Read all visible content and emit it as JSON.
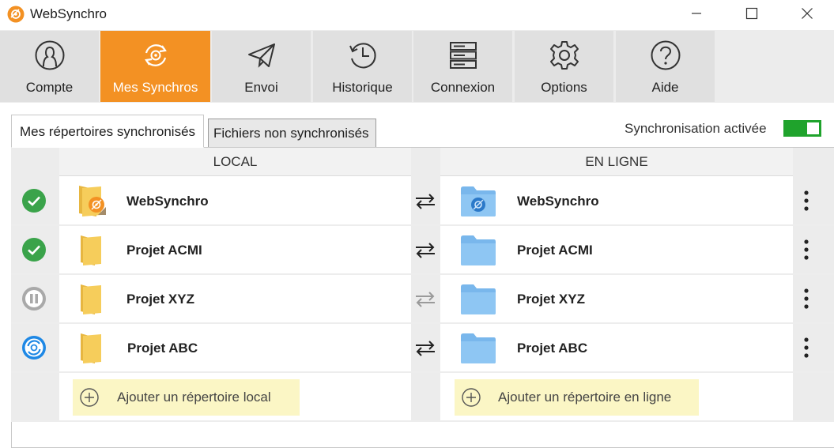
{
  "window": {
    "title": "WebSynchro",
    "controls": [
      "minimize-icon",
      "maximize-icon",
      "close-icon"
    ]
  },
  "toolbar": {
    "items": [
      {
        "label": "Compte",
        "icon": "account-icon"
      },
      {
        "label": "Mes Synchros",
        "icon": "sync-icon",
        "active": true
      },
      {
        "label": "Envoi",
        "icon": "send-icon"
      },
      {
        "label": "Historique",
        "icon": "history-icon"
      },
      {
        "label": "Connexion",
        "icon": "server-icon"
      },
      {
        "label": "Options",
        "icon": "gear-icon"
      },
      {
        "label": "Aide",
        "icon": "help-icon"
      }
    ]
  },
  "tabs": {
    "active": "Mes répertoires synchronisés",
    "inactive": "Fichiers non synchronisés"
  },
  "sync_toggle": {
    "label": "Synchronisation activée",
    "enabled": true
  },
  "table": {
    "headers": {
      "local": "LOCAL",
      "online": "EN LIGNE"
    },
    "rows": [
      {
        "status": "synced-check-icon",
        "local": "WebSynchro",
        "online": "WebSynchro",
        "arrows": "active"
      },
      {
        "status": "synced-check-icon",
        "local": "Projet ACMI",
        "online": "Projet ACMI",
        "arrows": "active"
      },
      {
        "status": "paused-icon",
        "local": "Projet XYZ",
        "online": "Projet XYZ",
        "arrows": "disabled"
      },
      {
        "status": "syncing-icon",
        "local": "Projet ABC",
        "online": "Projet ABC",
        "arrows": "active"
      }
    ],
    "add_local": "Ajouter un répertoire local",
    "add_online": "Ajouter un répertoire en ligne"
  },
  "colors": {
    "accent": "#f39123",
    "toggle_on": "#1fa32c",
    "status_ok": "#3aa34a",
    "status_paused": "#a9a9a9",
    "status_syncing": "#1e88e5",
    "add_highlight": "#fbf6c5",
    "folder_local": "#f6cd5b",
    "folder_online": "#8ec6f3"
  }
}
